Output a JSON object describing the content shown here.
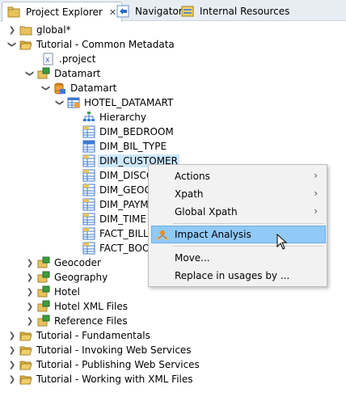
{
  "tabs": [
    {
      "label": "Project Explorer",
      "close": "✕"
    },
    {
      "label": "Navigator"
    },
    {
      "label": "Internal Resources"
    }
  ],
  "tree": {
    "global": "global*",
    "tutorial_common": "Tutorial - Common Metadata",
    "project_file": ".project",
    "datamart_folder": "Datamart",
    "datamart_db": "Datamart",
    "hotel_datamart": "HOTEL_DATAMART",
    "hierarchy": "Hierarchy",
    "dim_bedroom": "DIM_BEDROOM",
    "dim_bil_type": "DIM_BIL_TYPE",
    "dim_customer": "DIM_CUSTOMER",
    "dim_disc": "DIM_DISCO",
    "dim_geo": "DIM_GEOG",
    "dim_paym": "DIM_PAYM",
    "dim_time": "DIM_TIME",
    "fact_bill": "FACT_BILL",
    "fact_boo": "FACT_BOO",
    "geocoder": "Geocoder",
    "geography": "Geography",
    "hotel": "Hotel",
    "hotel_xml": "Hotel XML Files",
    "reference_files": "Reference Files",
    "tutorial_fundamentals": "Tutorial - Fundamentals",
    "tutorial_invoking": "Tutorial - Invoking Web Services",
    "tutorial_publishing": "Tutorial - Publishing Web Services",
    "tutorial_xml": "Tutorial - Working with XML Files"
  },
  "context_menu": {
    "actions": "Actions",
    "xpath": "Xpath",
    "global_xpath": "Global Xpath",
    "impact_analysis": "Impact Analysis",
    "move": "Move...",
    "replace": "Replace in usages by ...",
    "submenu_arrow": "›"
  },
  "colors": {
    "selection": "#cde8ff",
    "menu_highlight": "#91c9f7",
    "folder": "#e8c25a",
    "table_blue": "#3d7bd1"
  }
}
